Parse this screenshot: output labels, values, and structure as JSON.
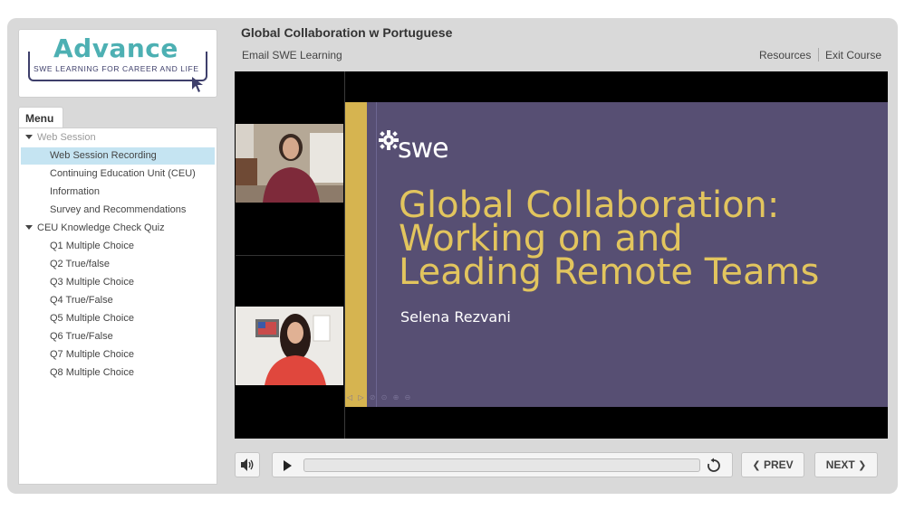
{
  "logo": {
    "wordmark": "Advance",
    "tagline": "SWE LEARNING FOR CAREER AND LIFE"
  },
  "header": {
    "title": "Global Collaboration w Portuguese",
    "email_link": "Email SWE Learning",
    "resources_link": "Resources",
    "exit_link": "Exit Course"
  },
  "menu": {
    "tab_label": "Menu",
    "sections": [
      {
        "label": "Web Session",
        "muted": true,
        "items": [
          {
            "label": "Web Session Recording",
            "selected": true
          },
          {
            "label": "Continuing Education Unit (CEU)"
          },
          {
            "label": "Information"
          },
          {
            "label": "Survey and Recommendations"
          }
        ]
      },
      {
        "label": "CEU Knowledge Check Quiz",
        "items": [
          {
            "label": "Q1 Multiple Choice"
          },
          {
            "label": "Q2 True/false"
          },
          {
            "label": "Q3 Multiple Choice"
          },
          {
            "label": "Q4 True/False"
          },
          {
            "label": "Q5 Multiple Choice"
          },
          {
            "label": "Q6 True/False"
          },
          {
            "label": "Q7 Multiple Choice"
          },
          {
            "label": "Q8 Multiple Choice"
          }
        ]
      }
    ]
  },
  "slide": {
    "brand": "swe",
    "title_lines": [
      "Global Collaboration:",
      "Working on and",
      "Leading Remote Teams"
    ],
    "presenter": "Selena Rezvani"
  },
  "controls": {
    "prev_label": "PREV",
    "next_label": "NEXT",
    "progress": 0,
    "icons": [
      "volume-icon",
      "play-icon",
      "replay-icon",
      "chevron-left-icon",
      "chevron-right-icon"
    ]
  },
  "colors": {
    "accent_teal": "#4db0b3",
    "navy": "#3e3f6b",
    "slide_bg": "#574f73",
    "slide_gold": "#d6b450",
    "slide_title": "#e2c55e",
    "selected_row": "#c5e4f2"
  }
}
